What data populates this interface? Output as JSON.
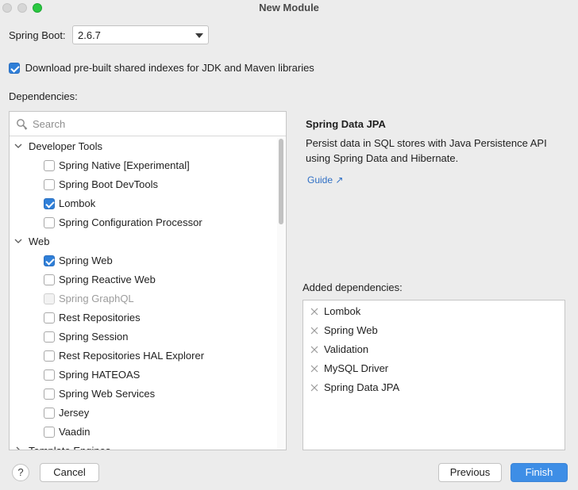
{
  "window": {
    "title": "New Module"
  },
  "spring_boot": {
    "label": "Spring Boot:",
    "selected": "2.6.7"
  },
  "download_indexes": {
    "label": "Download pre-built shared indexes for JDK and Maven libraries",
    "checked": true
  },
  "dependencies": {
    "label": "Dependencies:",
    "search_placeholder": "Search",
    "groups": [
      {
        "label": "Developer Tools",
        "expanded": true
      },
      {
        "label": "Web",
        "expanded": true
      },
      {
        "label": "Template Engines",
        "expanded": false
      }
    ],
    "items": [
      {
        "label": "Spring Native [Experimental]",
        "checked": false,
        "disabled": false
      },
      {
        "label": "Spring Boot DevTools",
        "checked": false,
        "disabled": false
      },
      {
        "label": "Lombok",
        "checked": true,
        "disabled": false
      },
      {
        "label": "Spring Configuration Processor",
        "checked": false,
        "disabled": false
      },
      {
        "label": "Spring Web",
        "checked": true,
        "disabled": false
      },
      {
        "label": "Spring Reactive Web",
        "checked": false,
        "disabled": false
      },
      {
        "label": "Spring GraphQL",
        "checked": false,
        "disabled": true
      },
      {
        "label": "Rest Repositories",
        "checked": false,
        "disabled": false
      },
      {
        "label": "Spring Session",
        "checked": false,
        "disabled": false
      },
      {
        "label": "Rest Repositories HAL Explorer",
        "checked": false,
        "disabled": false
      },
      {
        "label": "Spring HATEOAS",
        "checked": false,
        "disabled": false
      },
      {
        "label": "Spring Web Services",
        "checked": false,
        "disabled": false
      },
      {
        "label": "Jersey",
        "checked": false,
        "disabled": false
      },
      {
        "label": "Vaadin",
        "checked": false,
        "disabled": false
      }
    ]
  },
  "detail": {
    "title": "Spring Data JPA",
    "description": "Persist data in SQL stores with Java Persistence API using Spring Data and Hibernate.",
    "guide_label": "Guide ↗"
  },
  "added": {
    "label": "Added dependencies:",
    "items": [
      "Lombok",
      "Spring Web",
      "Validation",
      "MySQL Driver",
      "Spring Data JPA"
    ]
  },
  "buttons": {
    "help": "?",
    "cancel": "Cancel",
    "previous": "Previous",
    "finish": "Finish"
  },
  "colors": {
    "accent": "#2f7fd8",
    "primary_button": "#3e8ee6",
    "link": "#2f6fc5"
  }
}
